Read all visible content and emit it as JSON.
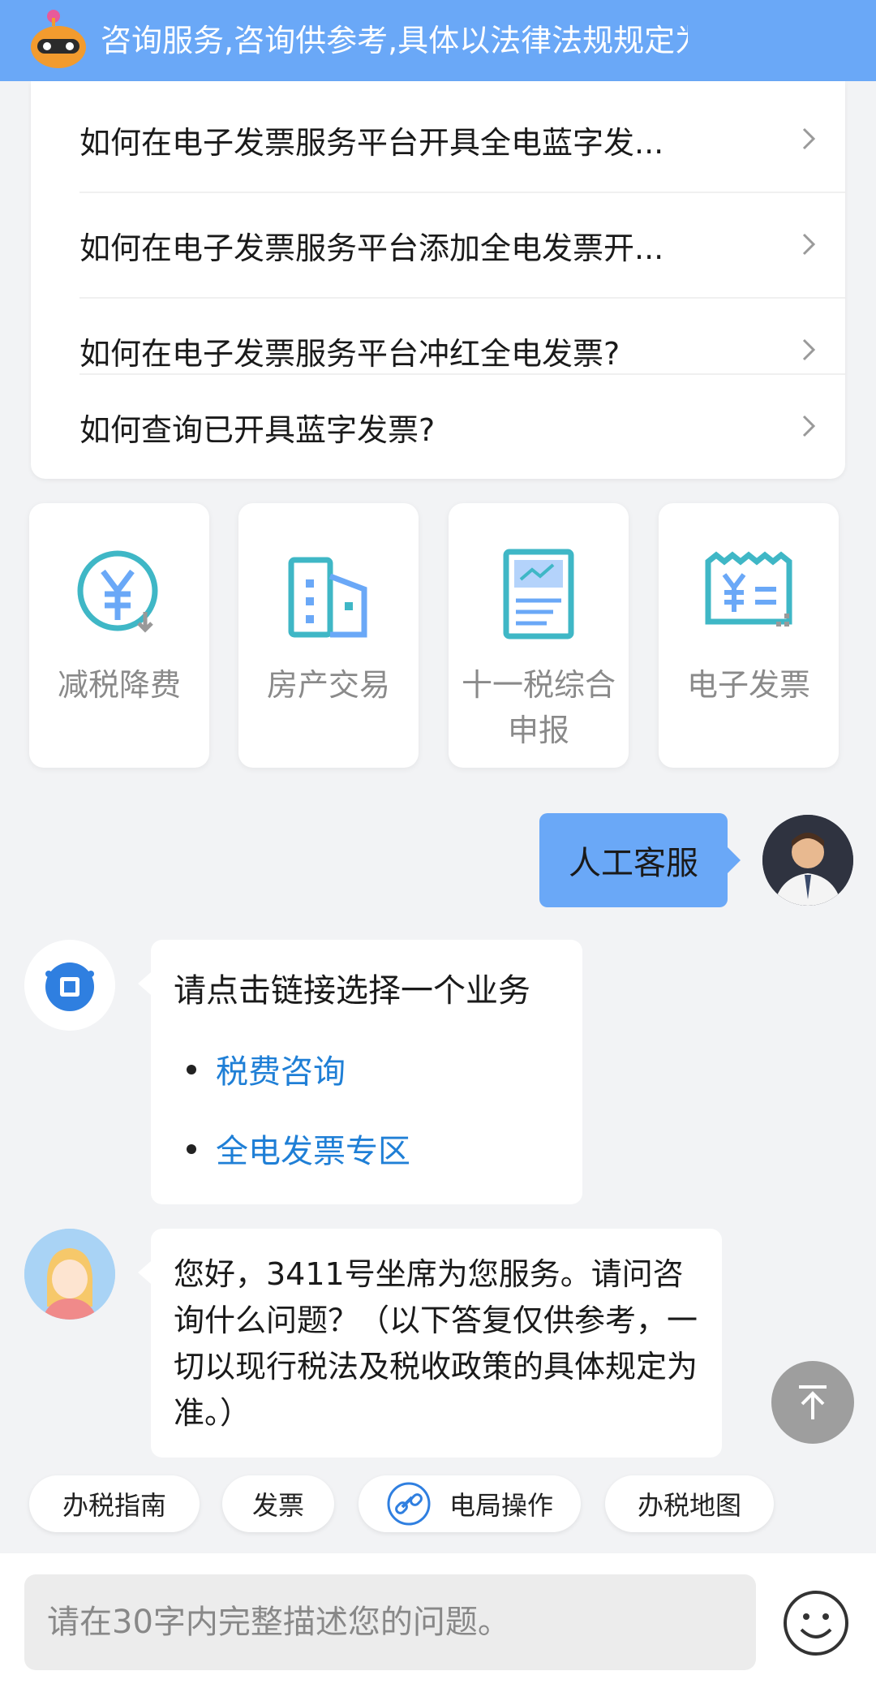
{
  "banner": {
    "text": "咨询服务,咨询供参考,具体以法律法规规定为"
  },
  "faq": {
    "items": [
      {
        "label": "如何在电子发票服务平台开具全电蓝字发..."
      },
      {
        "label": "如何在电子发票服务平台添加全电发票开..."
      },
      {
        "label": "如何在电子发票服务平台冲红全电发票?"
      },
      {
        "label": "如何查询已开具蓝字发票?"
      }
    ]
  },
  "services": [
    {
      "label": "减税降费",
      "icon": "yuan-coin-icon"
    },
    {
      "label": "房产交易",
      "icon": "building-icon"
    },
    {
      "label": "十一税综合申报",
      "label_line1": "十一税综合",
      "label_line2": "申报",
      "icon": "report-chart-icon"
    },
    {
      "label": "电子发票",
      "icon": "e-invoice-icon"
    }
  ],
  "chat": {
    "user_message": "人工客服",
    "bot_message": {
      "title": "请点击链接选择一个业务",
      "links": [
        "税费咨询",
        "全电发票专区"
      ]
    },
    "agent_message": "您好，3411号坐席为您服务。请问咨询什么问题？（以下答复仅供参考，一切以现行税法及税收政策的具体规定为准。）"
  },
  "chips": [
    "办税指南",
    "发票",
    "电局操作",
    "办税地图"
  ],
  "input": {
    "placeholder": "请在30字内完整描述您的问题。"
  },
  "colors": {
    "primary": "#6aa8f7",
    "link": "#1f7fd6",
    "icon_teal": "#3fb7c6"
  }
}
